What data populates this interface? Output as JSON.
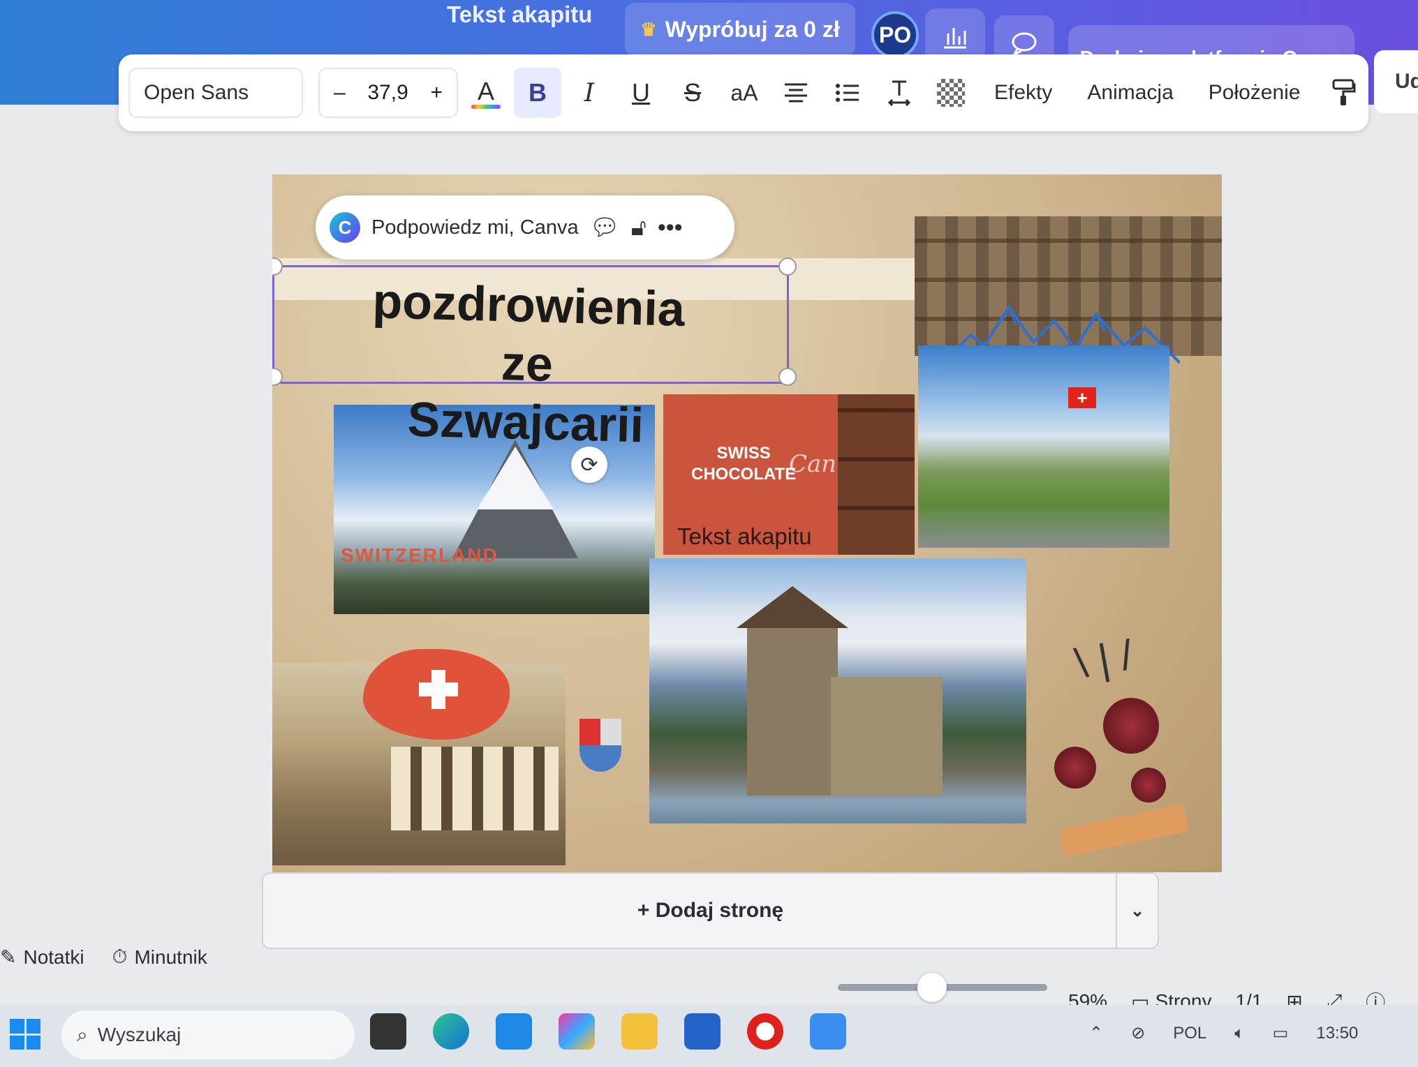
{
  "header": {
    "doc_title": "Tekst akapitu",
    "try_label": "Wypróbuj za 0 zł",
    "avatar_initials": "PO",
    "print_label": "Drukuj na platformie Canva",
    "share_label": "Ud"
  },
  "toolbar": {
    "font": "Open Sans",
    "size_minus": "–",
    "size_value": "37,9",
    "size_plus": "+",
    "text_color_glyph": "A",
    "bold": "B",
    "italic": "I",
    "underline": "U",
    "strike": "S",
    "case": "aA",
    "effects": "Efekty",
    "animation": "Animacja",
    "position": "Położenie"
  },
  "canvas": {
    "assistant_prompt": "Podpowiedz mi, Canva",
    "heading_line1": "pozdrowienia ze",
    "heading_line2": "Szwajcarii",
    "matterhorn_label": "SWITZERLAND",
    "choc_title_1": "SWISS",
    "choc_title_2": "CHOCOLATE",
    "choc_brand": "Canva",
    "choc_paragraph": "Tekst akapitu"
  },
  "footer": {
    "add_page": "+ Dodaj stronę",
    "notes": "Notatki",
    "timer": "Minutnik",
    "zoom": "59%",
    "zoom_fraction": 0.45,
    "pages_label": "Strony",
    "page_count": "1/1"
  },
  "taskbar": {
    "search_placeholder": "Wyszukaj",
    "lang": "POL",
    "time": "13:50"
  },
  "colors": {
    "header_start": "#2f7fd6",
    "header_end": "#6a4fe0",
    "selection": "#7b63d6",
    "swiss_red": "#e1523a"
  }
}
